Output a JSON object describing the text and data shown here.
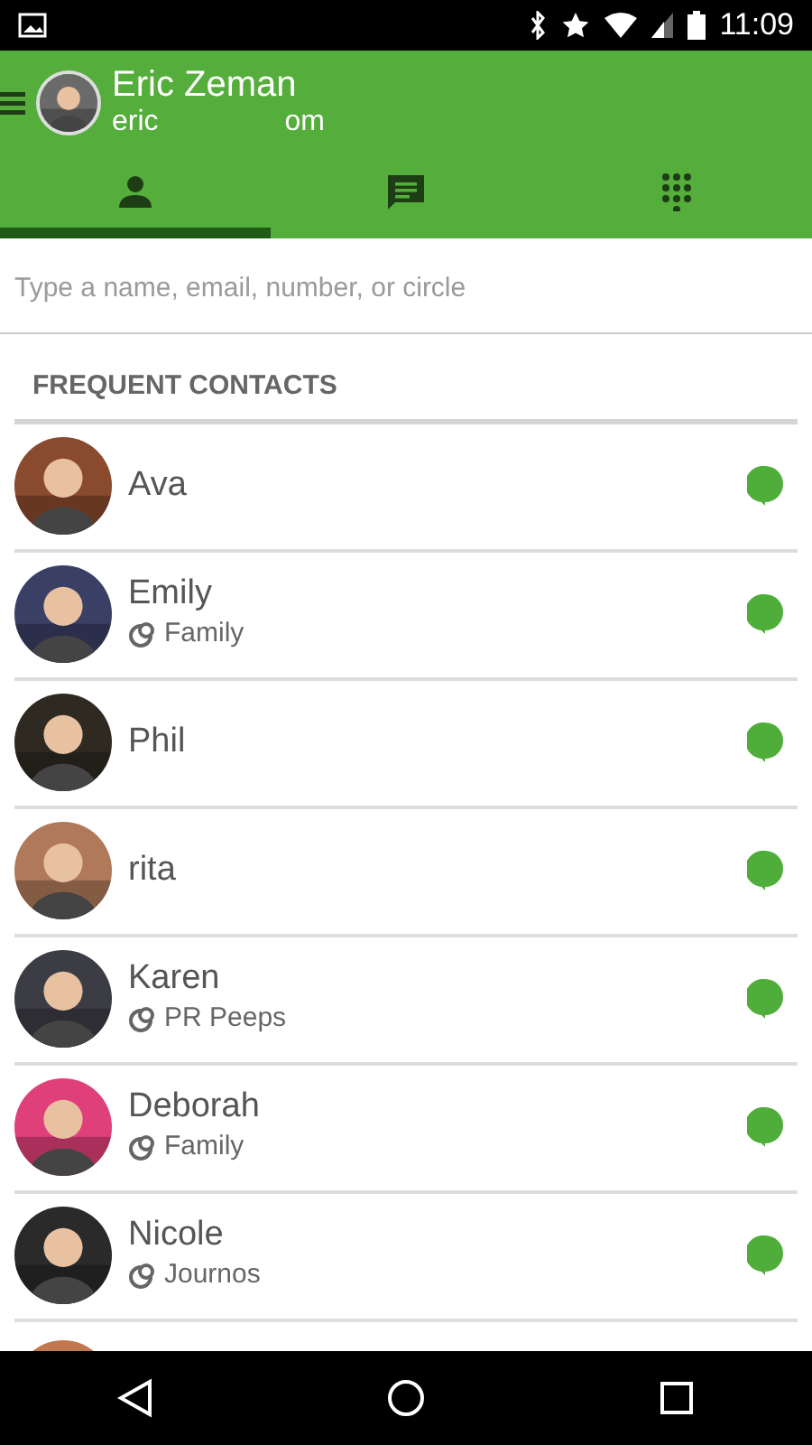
{
  "status_bar": {
    "time": "11:09"
  },
  "account": {
    "name": "Eric Zeman",
    "email_start": "eric",
    "email_end": "om"
  },
  "tabs": [
    {
      "kind": "contacts",
      "selected": true
    },
    {
      "kind": "messages",
      "selected": false
    },
    {
      "kind": "dialpad",
      "selected": false
    }
  ],
  "search": {
    "placeholder": "Type a name, email, number, or circle"
  },
  "section_title": "FREQUENT CONTACTS",
  "contacts": [
    {
      "name": "Ava"
    },
    {
      "name": "Emily",
      "circle": "Family"
    },
    {
      "name": "Phil"
    },
    {
      "name": "rita"
    },
    {
      "name": "Karen",
      "circle": "PR Peeps"
    },
    {
      "name": "Deborah",
      "circle": "Family"
    },
    {
      "name": "Nicole",
      "circle": "Journos"
    }
  ]
}
